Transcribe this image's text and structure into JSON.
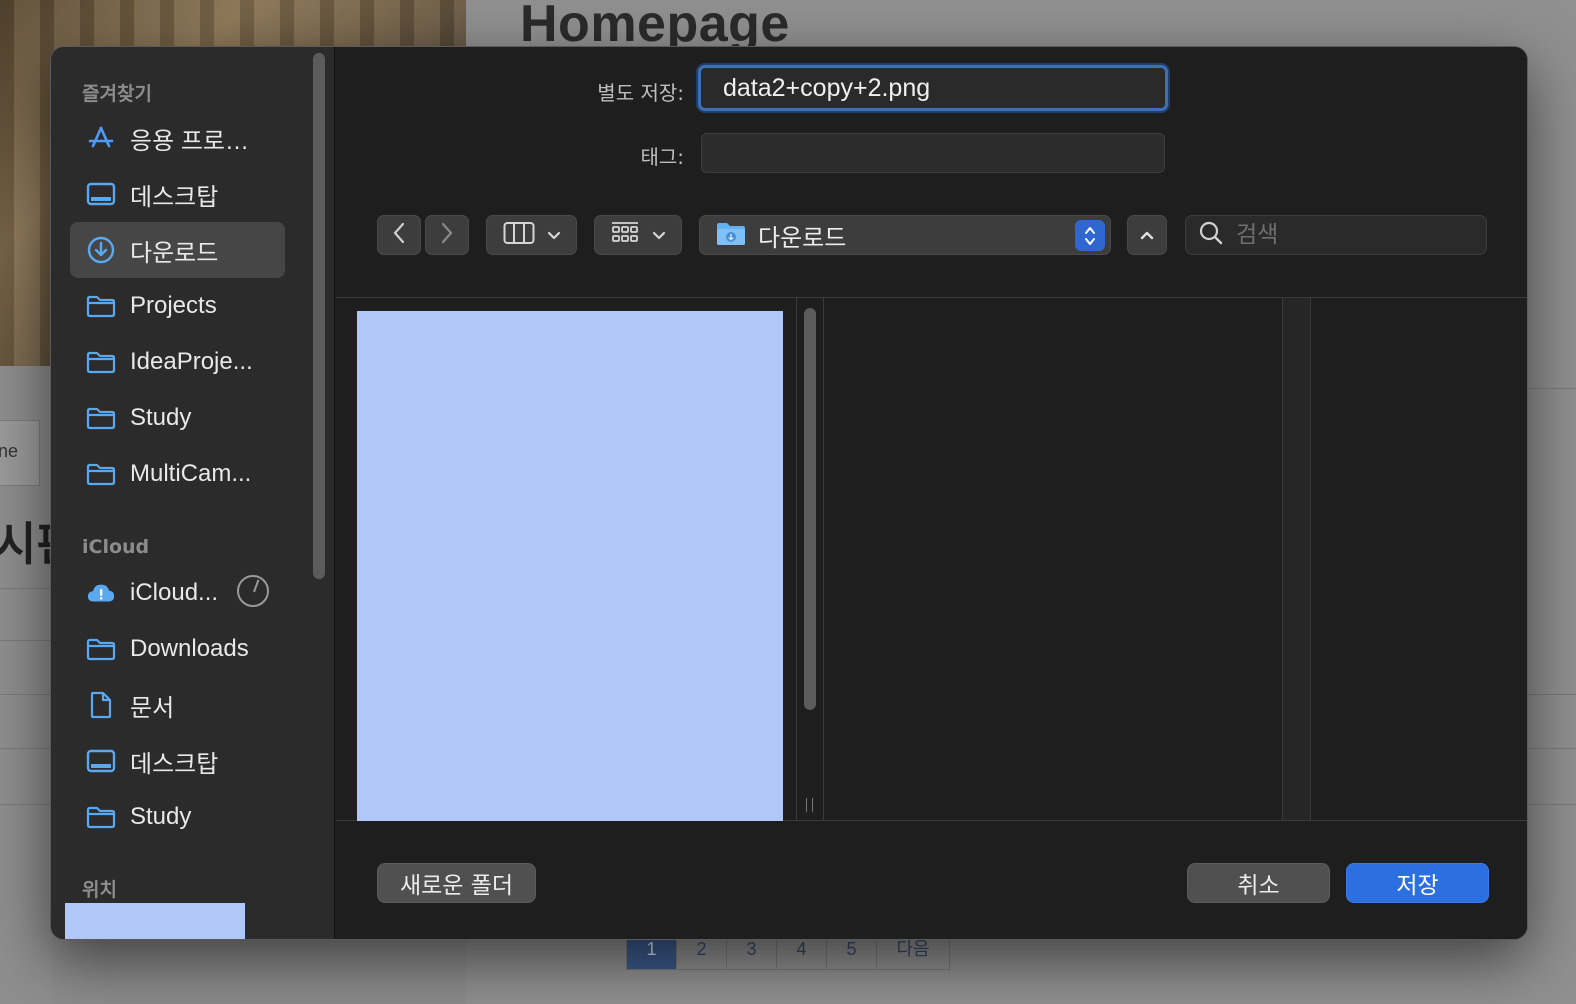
{
  "background": {
    "page_title": "Homepage",
    "left_tab_text": "ne",
    "left_heading_fragment": "시판",
    "pager": [
      "1",
      "2",
      "3",
      "4",
      "5",
      "다음"
    ]
  },
  "dialog": {
    "save_as_label": "별도 저장:",
    "filename_value": "data2+copy+2.png",
    "tags_label": "태그:",
    "tags_value": "",
    "path_popup_label": "다운로드",
    "search_placeholder": "검색",
    "new_folder_label": "새로운 폴더",
    "cancel_label": "취소",
    "save_label": "저장"
  },
  "sidebar": {
    "favorites_title": "즐겨찾기",
    "favorites": [
      {
        "label": "응용 프로…",
        "icon": "applications-icon"
      },
      {
        "label": "데스크탑",
        "icon": "desktop-icon"
      },
      {
        "label": "다운로드",
        "icon": "downloads-icon",
        "selected": true
      },
      {
        "label": "Projects",
        "icon": "folder-icon"
      },
      {
        "label": "IdeaProje...",
        "icon": "folder-icon"
      },
      {
        "label": "Study",
        "icon": "folder-icon"
      },
      {
        "label": "MultiCam...",
        "icon": "folder-icon"
      }
    ],
    "icloud_title": "iCloud",
    "icloud": [
      {
        "label": "iCloud...",
        "icon": "icloud-warning-icon"
      },
      {
        "label": "Downloads",
        "icon": "folder-icon"
      },
      {
        "label": "문서",
        "icon": "document-icon"
      },
      {
        "label": "데스크탑",
        "icon": "desktop-icon"
      },
      {
        "label": "Study",
        "icon": "folder-icon"
      }
    ],
    "locations_title": "위치"
  },
  "colors": {
    "accent": "#2c6fe0",
    "folder_icon": "#5aa9f0",
    "preview_fill": "#b0c7f8"
  }
}
